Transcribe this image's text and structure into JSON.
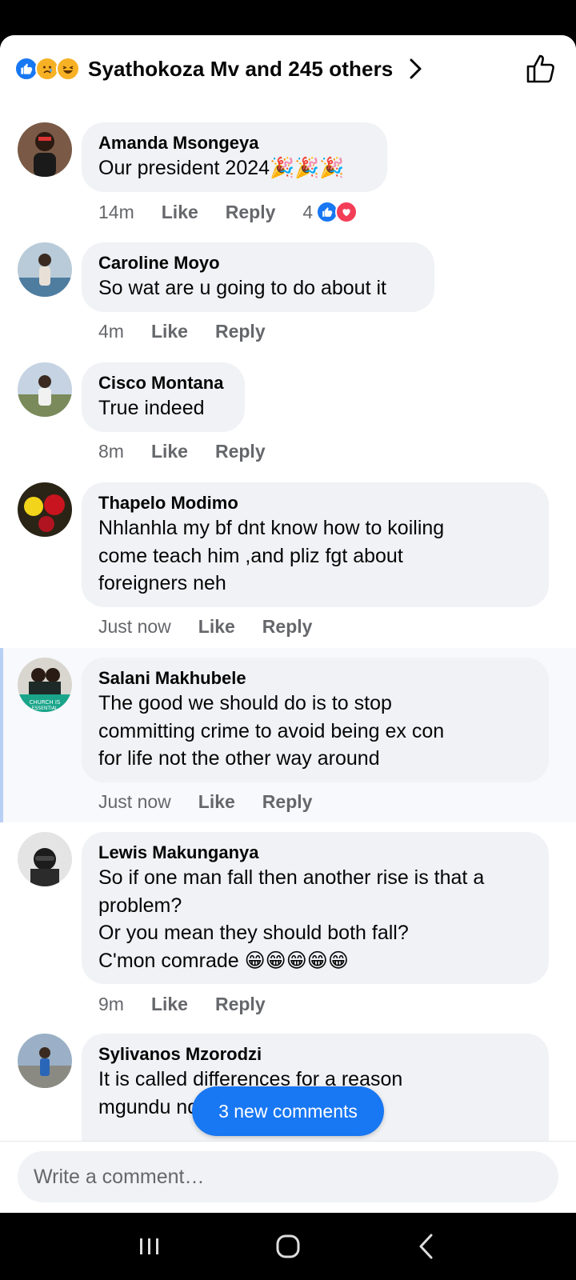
{
  "header": {
    "reactions": [
      "like-icon",
      "sad-icon",
      "haha-icon"
    ],
    "text": "Syathokoza Mv and 245 others"
  },
  "comments": [
    {
      "name": "Amanda Msongeya",
      "text": "Our president 2024🎉🎉🎉",
      "time": "14m",
      "like": "Like",
      "reply": "Reply",
      "reaction_count": "4",
      "reactions": [
        "like-icon",
        "love-icon"
      ],
      "avatar_color": "#5a3b2e"
    },
    {
      "name": "Caroline Moyo",
      "text": "So wat are u going to do about it",
      "time": "4m",
      "like": "Like",
      "reply": "Reply",
      "avatar_color": "#9fb4c4"
    },
    {
      "name": "Cisco Montana",
      "text": "True indeed",
      "time": "8m",
      "like": "Like",
      "reply": "Reply",
      "avatar_color": "#a9b8c9"
    },
    {
      "name": "Thapelo Modimo",
      "text": "Nhlanhla my bf dnt know how to koiling\ncome teach him ,and pliz fgt about\nforeigners neh",
      "time": "Just now",
      "like": "Like",
      "reply": "Reply",
      "avatar_color": "#3a2a1c"
    },
    {
      "name": "Salani Makhubele",
      "text": "The good we should do is to stop\ncommitting  crime  to avoid being ex con\nfor life not the other way around",
      "time": "Just now",
      "like": "Like",
      "reply": "Reply",
      "avatar_color": "#2d3d3a",
      "avatar_caption": "CHURCH IS ESSENTIAL"
    },
    {
      "name": "Lewis Makunganya",
      "text": "So if one man fall then another rise is that a\nproblem?\nOr you mean they should both fall?\nC'mon comrade 😁😁😁😁😁",
      "time": "9m",
      "like": "Like",
      "reply": "Reply",
      "avatar_color": "#d8d8d8"
    },
    {
      "name": "Sylivanos Mzorodzi",
      "text": "It is called differences for a reason\nmgundu ndm",
      "avatar_color": "#7f93a8"
    }
  ],
  "new_comments_pill": "3 new comments",
  "composer": {
    "placeholder": "Write a comment…"
  },
  "colors": {
    "accent": "#1877f2",
    "bubble": "#f0f2f5",
    "meta": "#65676b"
  }
}
